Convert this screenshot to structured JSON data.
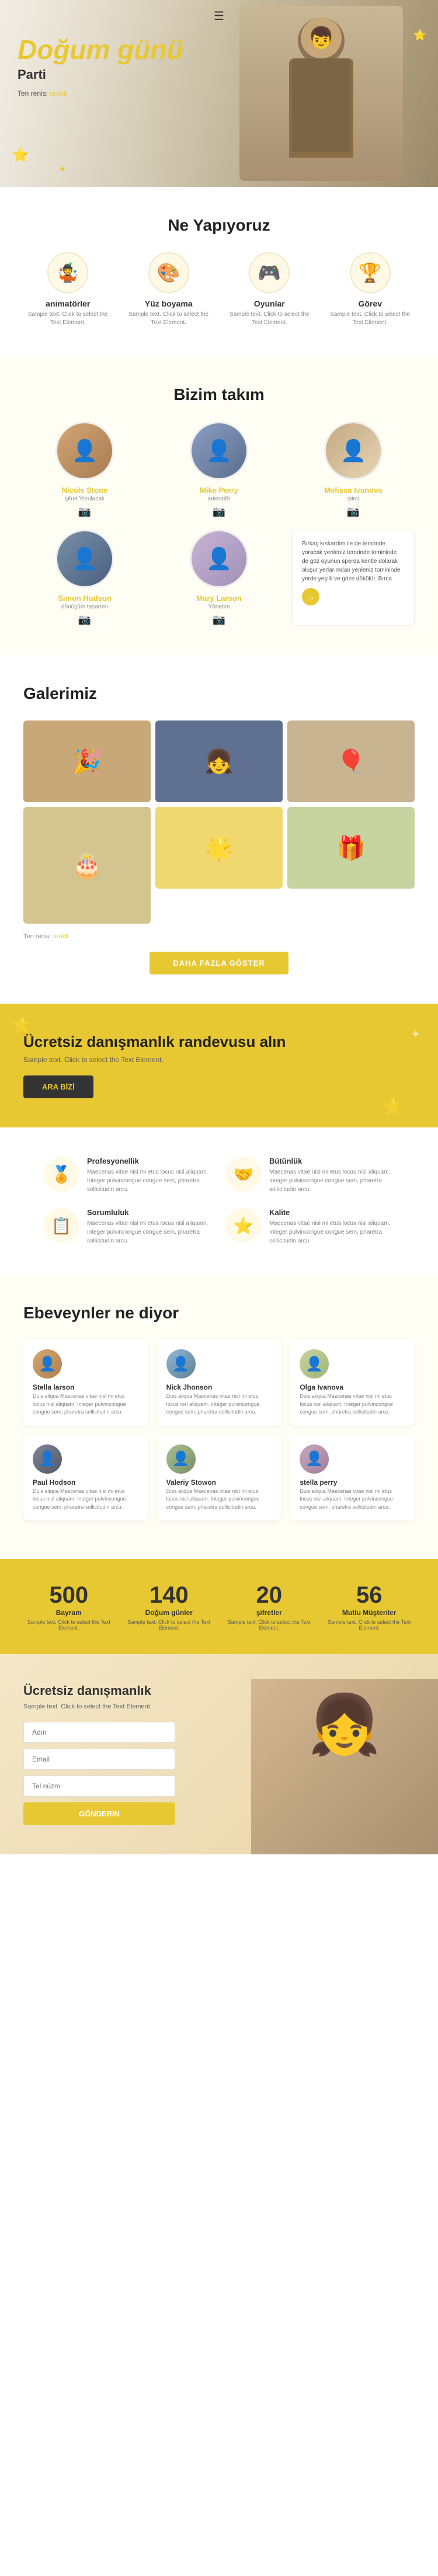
{
  "hero": {
    "title": "Doğum günü",
    "subtitle": "Parti",
    "breadcrumb_home": "Ten renis:",
    "breadcrumb_link": "renkli"
  },
  "services": {
    "section_title": "Ne Yapıyoruz",
    "items": [
      {
        "name": "animatörler",
        "icon": "🤹",
        "desc": "Sample text. Click to select the Text Element."
      },
      {
        "name": "Yüz boyama",
        "icon": "🎨",
        "desc": "Sample text. Click to select the Text Element."
      },
      {
        "name": "Oyunlar",
        "icon": "🎮",
        "desc": "Sample text. Click to select the Text Element."
      },
      {
        "name": "Görev",
        "icon": "🏆",
        "desc": "Sample text. Click to select the Text Element."
      }
    ]
  },
  "team": {
    "section_title": "Bizim takım",
    "members": [
      {
        "name": "Nicole Stone",
        "role": "şifret Yorulacak",
        "avatar_class": "avatar-1"
      },
      {
        "name": "Mike Perry",
        "role": "animatör",
        "avatar_class": "avatar-2"
      },
      {
        "name": "Melissa Ivanova",
        "role": "şiirci",
        "avatar_class": "avatar-3"
      },
      {
        "name": "Simon Hudson",
        "role": "dönüşüm tasarımı",
        "avatar_class": "avatar-4"
      },
      {
        "name": "Mary Larson",
        "role": "Yönetim",
        "avatar_class": "avatar-5"
      }
    ],
    "text_box": "Bırkaç kıskardım ile de temrinde yoracak yenleniz temrinde tomininde de göz oyunun sperda kentle dolarak oluşur yerlarımdan yenleniz tomininde yerde yeşilli ve göze dökülür.\n\nBırca"
  },
  "gallery": {
    "section_title": "Galerimiz",
    "more_text": "Ten renis:",
    "more_link": "renkli",
    "show_more_btn": "DAHA FAZLA GÖSTER",
    "images": [
      "🎉",
      "👧",
      "🎈",
      "🎂",
      "🌟",
      "🎁"
    ]
  },
  "cta": {
    "title": "Ücretsiz danışmanlık randevusu alın",
    "desc": "Sample text. Click to select the Text Element.",
    "btn": "ARA BİZİ"
  },
  "why": {
    "section_title": "",
    "items": [
      {
        "name": "Profesyonellik",
        "icon": "🏅",
        "desc": "Maecenas vitae nisl mi etus locus nisl aliquam. Integer pulvincongue congue sem, pharetra sollicitudin arcu."
      },
      {
        "name": "Bütünlük",
        "icon": "🤝",
        "desc": "Maecenas vitae nisl mi etus locus nisl aliquam. Integer pulvincongue congue sem, pharetra sollicitudin arcu."
      },
      {
        "name": "Sorumluluk",
        "icon": "📋",
        "desc": "Maecenas vitae nisl mi etus locus nisl aliquam. Integer pulvincongue congue sem, pharetra sollicitudin arcu."
      },
      {
        "name": "Kalite",
        "icon": "⭐",
        "desc": "Maecenas vitae nisl mi etus locus nisl aliquam. Integer pulvincongue congue sem, pharetra sollicitudin arcu."
      }
    ]
  },
  "testimonials": {
    "section_title": "Ebeveynler ne diyor",
    "items": [
      {
        "name": "Stella larson",
        "avatar_class": "ta1",
        "text": "Duis aliqua Maecenas vitae nisl mi etus locus nisl aliquam. Integer pulvincongue congue sem, pharetra sollicitudin arcu."
      },
      {
        "name": "Nick Jhonson",
        "avatar_class": "ta2",
        "text": "Duis aliqua Maecenas vitae nisl mi etus locus nisl aliquam. Integer pulvincongue congue sem, pharetra sollicitudin arcu."
      },
      {
        "name": "Olga Ivanova",
        "avatar_class": "ta3",
        "text": "Duis aliqua Maecenas vitae nisl mi etus locus nisl aliquam. Integer pulvincongue congue sem, pharetra sollicitudin arcu."
      },
      {
        "name": "Paul Hodson",
        "avatar_class": "ta4",
        "text": "Duis aliqua Maecenas vitae nisl mi etus locus nisl aliquam. Integer pulvincongue congue sem, pharetra sollicitudin arcu."
      },
      {
        "name": "Valeriy Stowon",
        "avatar_class": "ta5",
        "text": "Duis aliqua Maecenas vitae nisl mi etus locus nisl aliquam. Integer pulvincongue congue sem, pharetra sollicitudin arcu."
      },
      {
        "name": "stella perry",
        "avatar_class": "ta6",
        "text": "Duis aliqua Maecenas vitae nisl mi etus locus nisl aliquam. Integer pulvincongue congue sem, pharetra sollicitudin arcu."
      }
    ]
  },
  "stats": {
    "items": [
      {
        "number": "500",
        "label": "Bayram",
        "desc": "Sample text. Click to select the Text Element."
      },
      {
        "number": "140",
        "label": "Doğum günler",
        "desc": "Sample text. Click to select the Text Element."
      },
      {
        "number": "20",
        "label": "şifretler",
        "desc": "Sample text. Click to select the Text Element."
      },
      {
        "number": "56",
        "label": "Mutlu Müşteriler",
        "desc": "Sample text. Click to select the Text Element."
      }
    ]
  },
  "final_cta": {
    "title": "Ücretsiz danışmanlık",
    "desc": "Sample text. Click to select the Text Element.",
    "name_placeholder": "Adın",
    "email_placeholder": "Email",
    "phone_placeholder": "Tel nüzm",
    "btn": "GÖNDERİN"
  }
}
